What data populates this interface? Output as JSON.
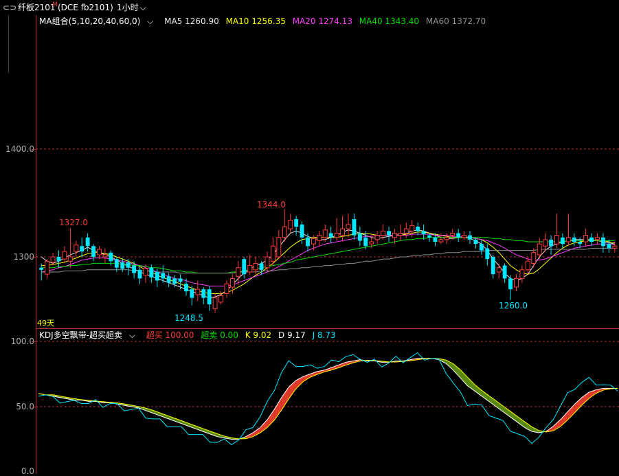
{
  "title": {
    "contract": "纤板2101",
    "marker": "M",
    "exchange": "(DCE fb2101)",
    "period": "1小时"
  },
  "main_legend": {
    "group": "MA组合(5,10,20,40,60,0)",
    "ma5": "MA5 1260.90",
    "ma10": "MA10 1256.35",
    "ma20": "MA20 1274.13",
    "ma40": "MA40 1343.40",
    "ma60": "MA60 1372.70"
  },
  "colors": {
    "up": "#ff3c3c",
    "down": "#00e8ff",
    "ma5": "#e8e8e8",
    "ma10": "#ffff00",
    "ma20": "#ff3cff",
    "ma40": "#00e000",
    "ma60": "#909090",
    "grid": "#b33",
    "k_line": "#ffffff",
    "d_line": "#ffff00",
    "j_line": "#00e8ff"
  },
  "price_axis": {
    "labels": [
      "1400.0",
      "1300"
    ],
    "note": "49天"
  },
  "annotations": {
    "high1": "1327.0",
    "high2": "1344.0",
    "low1": "1248.5",
    "low2": "1260.0"
  },
  "kdj_legend": {
    "name": "KDJ多空飘带-超买超卖",
    "overbought": "超买 100.00",
    "oversold": "超卖 0.00",
    "k": "K 9.02",
    "d": "D 9.17",
    "j": "J 8.73"
  },
  "kdj_axis": {
    "labels": [
      "100.0",
      "50.0",
      "0.0"
    ]
  },
  "chart_data": {
    "type": "candlestick",
    "price_ylim": [
      1230,
      1450
    ],
    "candles": [
      [
        1288,
        1290,
        1278,
        1294,
        0
      ],
      [
        1284,
        1296,
        1280,
        1298,
        1
      ],
      [
        1295,
        1300,
        1292,
        1304,
        1
      ],
      [
        1300,
        1296,
        1290,
        1306,
        0
      ],
      [
        1298,
        1305,
        1295,
        1310,
        1
      ],
      [
        1296,
        1300,
        1290,
        1327,
        1
      ],
      [
        1305,
        1311,
        1300,
        1315,
        1
      ],
      [
        1310,
        1305,
        1300,
        1318,
        0
      ],
      [
        1318,
        1310,
        1305,
        1322,
        0
      ],
      [
        1310,
        1300,
        1296,
        1312,
        0
      ],
      [
        1302,
        1307,
        1298,
        1310,
        1
      ],
      [
        1300,
        1302,
        1294,
        1308,
        1
      ],
      [
        1304,
        1296,
        1292,
        1306,
        0
      ],
      [
        1298,
        1290,
        1286,
        1300,
        0
      ],
      [
        1295,
        1289,
        1286,
        1299,
        0
      ],
      [
        1295,
        1290,
        1283,
        1298,
        0
      ],
      [
        1292,
        1285,
        1280,
        1296,
        0
      ],
      [
        1288,
        1280,
        1275,
        1291,
        0
      ],
      [
        1283,
        1289,
        1276,
        1293,
        1
      ],
      [
        1290,
        1281,
        1276,
        1293,
        0
      ],
      [
        1286,
        1278,
        1272,
        1289,
        0
      ],
      [
        1285,
        1280,
        1276,
        1292,
        0
      ],
      [
        1282,
        1276,
        1272,
        1285,
        0
      ],
      [
        1280,
        1275,
        1272,
        1283,
        0
      ],
      [
        1280,
        1277,
        1270,
        1284,
        0
      ],
      [
        1275,
        1268,
        1264,
        1280,
        0
      ],
      [
        1270,
        1262,
        1255,
        1273,
        0
      ],
      [
        1265,
        1270,
        1259,
        1278,
        1
      ],
      [
        1270,
        1262,
        1256,
        1272,
        0
      ],
      [
        1270,
        1256,
        1250,
        1273,
        0
      ],
      [
        1252,
        1262,
        1248,
        1266,
        1
      ],
      [
        1258,
        1264,
        1256,
        1268,
        1
      ],
      [
        1266,
        1275,
        1262,
        1278,
        1
      ],
      [
        1272,
        1280,
        1266,
        1284,
        1
      ],
      [
        1282,
        1290,
        1274,
        1296,
        1
      ],
      [
        1298,
        1284,
        1280,
        1300,
        0
      ],
      [
        1286,
        1292,
        1283,
        1302,
        1
      ],
      [
        1288,
        1294,
        1284,
        1300,
        1
      ],
      [
        1294,
        1288,
        1283,
        1296,
        0
      ],
      [
        1290,
        1300,
        1286,
        1305,
        1
      ],
      [
        1296,
        1310,
        1292,
        1318,
        1
      ],
      [
        1300,
        1318,
        1298,
        1325,
        1
      ],
      [
        1318,
        1328,
        1314,
        1344,
        1
      ],
      [
        1326,
        1334,
        1322,
        1340,
        1
      ],
      [
        1335,
        1328,
        1320,
        1338,
        0
      ],
      [
        1330,
        1318,
        1312,
        1333,
        0
      ],
      [
        1318,
        1310,
        1305,
        1322,
        0
      ],
      [
        1312,
        1317,
        1306,
        1320,
        1
      ],
      [
        1315,
        1320,
        1310,
        1324,
        1
      ],
      [
        1318,
        1325,
        1314,
        1330,
        1
      ],
      [
        1322,
        1318,
        1313,
        1328,
        0
      ],
      [
        1318,
        1322,
        1315,
        1336,
        1
      ],
      [
        1320,
        1326,
        1314,
        1338,
        1
      ],
      [
        1326,
        1330,
        1318,
        1340,
        1
      ],
      [
        1335,
        1320,
        1316,
        1340,
        0
      ],
      [
        1322,
        1315,
        1310,
        1328,
        0
      ],
      [
        1318,
        1310,
        1307,
        1324,
        0
      ],
      [
        1312,
        1314,
        1308,
        1320,
        1
      ],
      [
        1316,
        1320,
        1312,
        1324,
        1
      ],
      [
        1320,
        1324,
        1316,
        1330,
        1
      ],
      [
        1324,
        1320,
        1314,
        1328,
        0
      ],
      [
        1318,
        1322,
        1312,
        1326,
        1
      ],
      [
        1320,
        1322,
        1315,
        1330,
        1
      ],
      [
        1322,
        1326,
        1318,
        1332,
        1
      ],
      [
        1324,
        1329,
        1318,
        1334,
        1
      ],
      [
        1328,
        1324,
        1320,
        1332,
        0
      ],
      [
        1324,
        1321,
        1316,
        1330,
        0
      ],
      [
        1320,
        1318,
        1314,
        1322,
        0
      ],
      [
        1318,
        1314,
        1310,
        1322,
        0
      ],
      [
        1314,
        1316,
        1312,
        1322,
        1
      ],
      [
        1316,
        1318,
        1312,
        1322,
        1
      ],
      [
        1320,
        1322,
        1316,
        1326,
        1
      ],
      [
        1322,
        1318,
        1314,
        1326,
        0
      ],
      [
        1318,
        1320,
        1316,
        1324,
        1
      ],
      [
        1320,
        1316,
        1312,
        1324,
        0
      ],
      [
        1316,
        1312,
        1308,
        1318,
        0
      ],
      [
        1312,
        1306,
        1302,
        1316,
        0
      ],
      [
        1308,
        1298,
        1292,
        1312,
        0
      ],
      [
        1300,
        1284,
        1280,
        1302,
        0
      ],
      [
        1286,
        1290,
        1280,
        1294,
        1
      ],
      [
        1292,
        1280,
        1276,
        1294,
        0
      ],
      [
        1280,
        1270,
        1260,
        1283,
        0
      ],
      [
        1272,
        1280,
        1268,
        1284,
        1
      ],
      [
        1280,
        1288,
        1276,
        1292,
        1
      ],
      [
        1288,
        1296,
        1284,
        1300,
        1
      ],
      [
        1294,
        1304,
        1290,
        1308,
        1
      ],
      [
        1302,
        1312,
        1298,
        1318,
        1
      ],
      [
        1310,
        1316,
        1305,
        1322,
        1
      ],
      [
        1316,
        1310,
        1302,
        1320,
        0
      ],
      [
        1312,
        1320,
        1308,
        1340,
        1
      ],
      [
        1318,
        1312,
        1308,
        1322,
        0
      ],
      [
        1314,
        1318,
        1310,
        1340,
        1
      ],
      [
        1318,
        1314,
        1310,
        1322,
        0
      ],
      [
        1314,
        1312,
        1308,
        1318,
        0
      ],
      [
        1314,
        1320,
        1310,
        1326,
        1
      ],
      [
        1318,
        1314,
        1310,
        1322,
        0
      ],
      [
        1316,
        1318,
        1312,
        1322,
        1
      ],
      [
        1318,
        1310,
        1304,
        1322,
        0
      ],
      [
        1312,
        1308,
        1304,
        1316,
        0
      ],
      [
        1308,
        1310,
        1304,
        1314,
        1
      ]
    ],
    "ma_series": [
      {
        "name": "MA5",
        "values": [
          1300,
          1296,
          1294,
          1296,
          1299,
          1302,
          1304,
          1306,
          1309,
          1306,
          1304,
          1302,
          1300,
          1297,
          1294,
          1291,
          1289,
          1286,
          1284,
          1282,
          1280,
          1278,
          1276,
          1274,
          1272,
          1270,
          1268,
          1266,
          1264,
          1262,
          1263,
          1265,
          1269,
          1274,
          1280,
          1285,
          1289,
          1292,
          1294,
          1297,
          1302,
          1309,
          1316,
          1322,
          1324,
          1322,
          1319,
          1317,
          1316,
          1316,
          1318,
          1320,
          1323,
          1325,
          1324,
          1322,
          1320,
          1318,
          1317,
          1318,
          1319,
          1320,
          1321,
          1322,
          1324,
          1325,
          1324,
          1322,
          1320,
          1318,
          1317,
          1317,
          1318,
          1318,
          1317,
          1315,
          1312,
          1306,
          1298,
          1292,
          1285,
          1280,
          1278,
          1280,
          1284,
          1292,
          1300,
          1306,
          1310,
          1312,
          1314,
          1315,
          1316,
          1316,
          1316,
          1316,
          1315,
          1314,
          1313,
          1312
        ]
      },
      {
        "name": "MA10",
        "values": [
          1292,
          1292,
          1293,
          1294,
          1295,
          1297,
          1299,
          1301,
          1303,
          1304,
          1304,
          1303,
          1302,
          1300,
          1298,
          1296,
          1294,
          1291,
          1288,
          1286,
          1283,
          1281,
          1279,
          1277,
          1275,
          1273,
          1271,
          1269,
          1267,
          1266,
          1266,
          1266,
          1267,
          1269,
          1272,
          1275,
          1279,
          1283,
          1286,
          1290,
          1294,
          1299,
          1304,
          1309,
          1313,
          1316,
          1317,
          1318,
          1318,
          1318,
          1318,
          1318,
          1319,
          1320,
          1321,
          1322,
          1322,
          1321,
          1320,
          1320,
          1320,
          1320,
          1320,
          1321,
          1322,
          1323,
          1323,
          1322,
          1321,
          1320,
          1319,
          1318,
          1318,
          1318,
          1318,
          1317,
          1316,
          1313,
          1309,
          1304,
          1298,
          1292,
          1288,
          1285,
          1284,
          1285,
          1289,
          1294,
          1299,
          1304,
          1308,
          1311,
          1313,
          1314,
          1315,
          1315,
          1315,
          1315,
          1314,
          1313
        ]
      },
      {
        "name": "MA20",
        "values": [
          1286,
          1287,
          1288,
          1290,
          1291,
          1293,
          1295,
          1297,
          1298,
          1299,
          1299,
          1299,
          1298,
          1297,
          1296,
          1295,
          1293,
          1292,
          1290,
          1288,
          1286,
          1284,
          1282,
          1280,
          1279,
          1278,
          1276,
          1275,
          1274,
          1273,
          1273,
          1273,
          1273,
          1274,
          1276,
          1278,
          1280,
          1282,
          1284,
          1286,
          1288,
          1291,
          1294,
          1297,
          1300,
          1303,
          1306,
          1308,
          1310,
          1312,
          1313,
          1314,
          1315,
          1316,
          1317,
          1318,
          1319,
          1319,
          1320,
          1320,
          1320,
          1320,
          1320,
          1320,
          1321,
          1321,
          1321,
          1321,
          1320,
          1320,
          1320,
          1319,
          1319,
          1319,
          1318,
          1317,
          1316,
          1315,
          1313,
          1311,
          1308,
          1305,
          1302,
          1300,
          1298,
          1297,
          1297,
          1298,
          1300,
          1302,
          1304,
          1306,
          1308,
          1309,
          1310,
          1311,
          1312,
          1312,
          1312,
          1311
        ]
      },
      {
        "name": "MA40",
        "values": [
          1290,
          1290,
          1290,
          1291,
          1291,
          1292,
          1292,
          1293,
          1293,
          1294,
          1294,
          1294,
          1294,
          1294,
          1293,
          1293,
          1292,
          1292,
          1291,
          1290,
          1290,
          1289,
          1288,
          1287,
          1287,
          1286,
          1286,
          1285,
          1285,
          1285,
          1285,
          1285,
          1285,
          1286,
          1286,
          1287,
          1288,
          1289,
          1290,
          1291,
          1292,
          1293,
          1294,
          1295,
          1297,
          1298,
          1299,
          1300,
          1301,
          1302,
          1303,
          1304,
          1305,
          1306,
          1307,
          1308,
          1309,
          1310,
          1311,
          1312,
          1313,
          1314,
          1315,
          1316,
          1316,
          1317,
          1317,
          1318,
          1318,
          1318,
          1318,
          1318,
          1318,
          1318,
          1318,
          1318,
          1318,
          1318,
          1317,
          1317,
          1316,
          1316,
          1315,
          1315,
          1314,
          1314,
          1314,
          1314,
          1314,
          1314,
          1314,
          1315,
          1315,
          1315,
          1315,
          1315,
          1315,
          1315,
          1315,
          1315
        ]
      },
      {
        "name": "MA60",
        "values": [
          1286,
          1286,
          1286,
          1286,
          1287,
          1287,
          1287,
          1287,
          1288,
          1288,
          1288,
          1288,
          1288,
          1288,
          1288,
          1288,
          1287,
          1287,
          1287,
          1287,
          1286,
          1286,
          1286,
          1286,
          1285,
          1285,
          1285,
          1285,
          1285,
          1285,
          1285,
          1285,
          1285,
          1285,
          1286,
          1286,
          1286,
          1286,
          1287,
          1287,
          1287,
          1288,
          1288,
          1289,
          1289,
          1290,
          1290,
          1291,
          1291,
          1292,
          1292,
          1293,
          1293,
          1294,
          1294,
          1295,
          1296,
          1296,
          1297,
          1298,
          1298,
          1299,
          1300,
          1300,
          1301,
          1301,
          1302,
          1302,
          1303,
          1303,
          1304,
          1304,
          1304,
          1305,
          1305,
          1305,
          1305,
          1306,
          1306,
          1306,
          1306,
          1306,
          1306,
          1306,
          1306,
          1306,
          1307,
          1307,
          1307,
          1307,
          1307,
          1307,
          1307,
          1307,
          1307,
          1308,
          1308,
          1308,
          1308,
          1308
        ]
      }
    ],
    "kdj_ylim": [
      0,
      100
    ],
    "kdj": {
      "K": [
        60,
        59,
        58,
        57,
        56,
        55,
        55,
        54,
        54,
        53,
        53,
        52,
        51,
        50,
        49,
        47,
        45,
        43,
        41,
        39,
        37,
        35,
        33,
        31,
        29,
        27,
        26,
        25,
        25,
        27,
        30,
        34,
        40,
        48,
        57,
        65,
        70,
        73,
        75,
        77,
        78,
        80,
        82,
        84,
        85,
        86,
        85,
        85,
        84,
        84,
        85,
        85,
        86,
        87,
        87,
        87,
        86,
        83,
        78,
        72,
        66,
        62,
        58,
        54,
        50,
        46,
        42,
        38,
        34,
        31,
        30,
        31,
        35,
        40,
        46,
        52,
        57,
        61,
        63,
        64,
        64,
        64
      ]
    }
  }
}
